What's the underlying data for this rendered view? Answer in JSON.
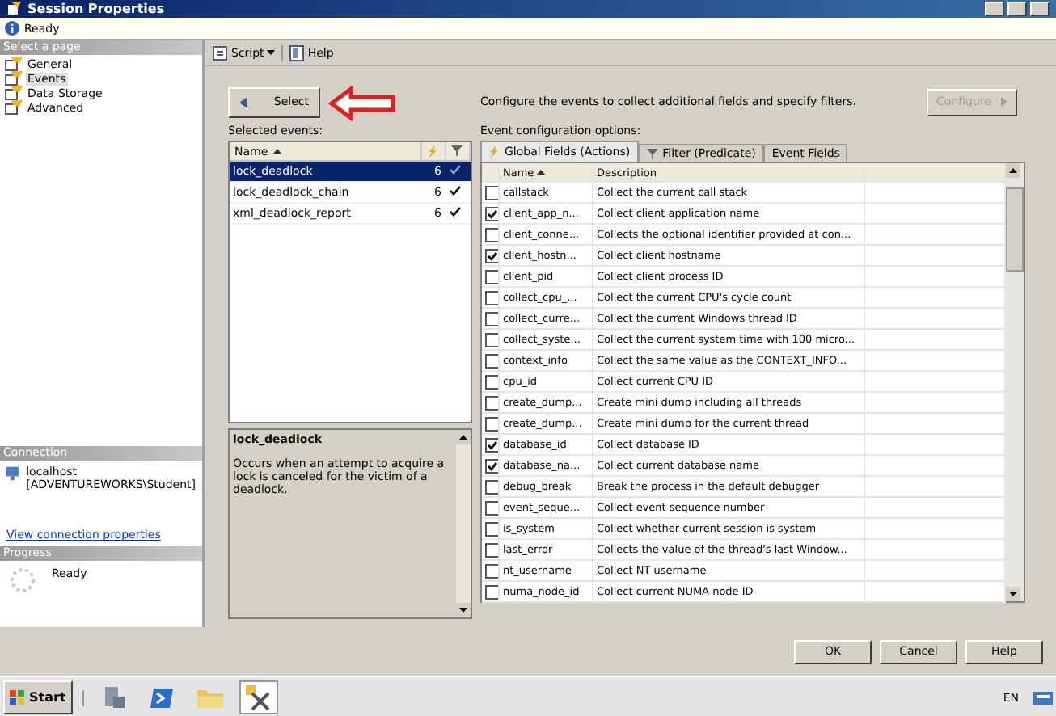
{
  "window": {
    "title": "Session Properties"
  },
  "status": {
    "text": "Ready"
  },
  "sidebar": {
    "header": "Select a page",
    "items": [
      {
        "label": "General",
        "selected": false
      },
      {
        "label": "Events",
        "selected": true
      },
      {
        "label": "Data Storage",
        "selected": false
      },
      {
        "label": "Advanced",
        "selected": false
      }
    ],
    "connection": {
      "header": "Connection",
      "server": "localhost",
      "user": "[ADVENTUREWORKS\\Student]",
      "link": "View connection properties"
    },
    "progress": {
      "header": "Progress",
      "text": "Ready"
    }
  },
  "toolbar": {
    "script": "Script",
    "help": "Help"
  },
  "select_button": "Select",
  "instructions": "Configure the events to collect additional fields and specify filters.",
  "configure_button": {
    "label": "Configure",
    "disabled": true
  },
  "selected_events": {
    "label": "Selected events:",
    "column": "Name",
    "rows": [
      {
        "name": "lock_deadlock",
        "count": "6",
        "filtered": true,
        "selected": true
      },
      {
        "name": "lock_deadlock_chain",
        "count": "6",
        "filtered": true,
        "selected": false
      },
      {
        "name": "xml_deadlock_report",
        "count": "6",
        "filtered": true,
        "selected": false
      }
    ]
  },
  "description": {
    "title": "lock_deadlock",
    "text": "Occurs when an attempt to acquire a lock is canceled for the victim of a deadlock."
  },
  "config": {
    "label": "Event configuration options:",
    "tabs": [
      {
        "label": "Global Fields (Actions)",
        "selected": true,
        "kind": "actions"
      },
      {
        "label": "Filter (Predicate)",
        "selected": false,
        "kind": "filter"
      },
      {
        "label": "Event Fields",
        "selected": false,
        "kind": "plain"
      }
    ],
    "columns": [
      "Name",
      "Description"
    ],
    "rows": [
      {
        "checked": false,
        "name": "callstack",
        "description": "Collect the current call stack"
      },
      {
        "checked": true,
        "name": "client_app_n...",
        "description": "Collect client application name"
      },
      {
        "checked": false,
        "name": "client_conne...",
        "description": "Collects the optional identifier provided at con..."
      },
      {
        "checked": true,
        "name": "client_hostn...",
        "description": "Collect client hostname"
      },
      {
        "checked": false,
        "name": "client_pid",
        "description": "Collect client process ID"
      },
      {
        "checked": false,
        "name": "collect_cpu_...",
        "description": "Collect the current CPU's cycle count"
      },
      {
        "checked": false,
        "name": "collect_curre...",
        "description": "Collect the current Windows thread ID"
      },
      {
        "checked": false,
        "name": "collect_syste...",
        "description": "Collect the current system time with 100 micro..."
      },
      {
        "checked": false,
        "name": "context_info",
        "description": "Collect the same value as the CONTEXT_INFO..."
      },
      {
        "checked": false,
        "name": "cpu_id",
        "description": "Collect current CPU ID"
      },
      {
        "checked": false,
        "name": "create_dump...",
        "description": "Create mini dump including all threads"
      },
      {
        "checked": false,
        "name": "create_dump...",
        "description": "Create mini dump for the current thread"
      },
      {
        "checked": true,
        "name": "database_id",
        "description": "Collect database ID"
      },
      {
        "checked": true,
        "name": "database_na...",
        "description": "Collect current database name"
      },
      {
        "checked": false,
        "name": "debug_break",
        "description": "Break the process in the default debugger"
      },
      {
        "checked": false,
        "name": "event_seque...",
        "description": "Collect event sequence number"
      },
      {
        "checked": false,
        "name": "is_system",
        "description": "Collect whether current session is system"
      },
      {
        "checked": false,
        "name": "last_error",
        "description": "Collects the value of the thread's last Window..."
      },
      {
        "checked": false,
        "name": "nt_username",
        "description": "Collect NT username"
      },
      {
        "checked": false,
        "name": "numa_node_id",
        "description": "Collect current NUMA node ID"
      }
    ]
  },
  "buttons": [
    "OK",
    "Cancel",
    "Help"
  ],
  "taskbar": {
    "start": "Start",
    "language": "EN",
    "apps": [
      {
        "kind": "server",
        "selected": false
      },
      {
        "kind": "shell",
        "selected": false
      },
      {
        "kind": "folder",
        "selected": false
      },
      {
        "kind": "tools",
        "selected": true
      }
    ]
  }
}
